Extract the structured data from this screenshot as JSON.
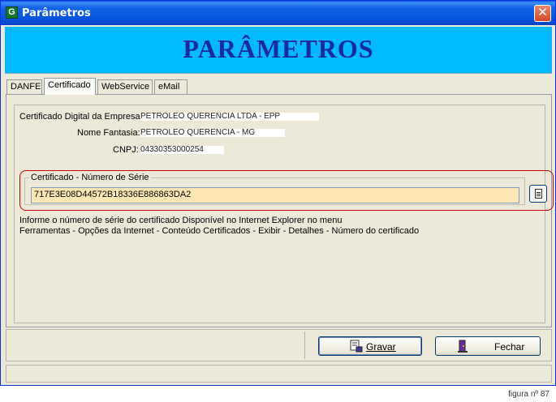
{
  "window": {
    "title": "Parâmetros",
    "close_glyph": "✕",
    "icon_glyph": "G"
  },
  "header": {
    "title": "PARÂMETROS"
  },
  "tabs": [
    {
      "label": "DANFE",
      "active": false
    },
    {
      "label": "Certificado",
      "active": true
    },
    {
      "label": "WebService",
      "active": false
    },
    {
      "label": "eMail",
      "active": false
    }
  ],
  "certificate": {
    "empresa_label": "Certificado Digital da Empresa:",
    "empresa_value": "PETROLEO QUERENCIA LTDA - EPP",
    "fantasia_label": "Nome Fantasia:",
    "fantasia_value": "PETROLEO QUERENCIA - MG",
    "cnpj_label": "CNPJ:",
    "cnpj_value": "04330353000254"
  },
  "serial_group": {
    "legend": "Certificado - Número de Série",
    "value": "717E3E08D44572B18336E886863DA2",
    "browse_icon": "document-icon"
  },
  "info": {
    "line1": "Informe o número de série do certificado Disponível no Internet Explorer no menu",
    "line2": "Ferramentas - Opções da Internet - Conteúdo Certificados - Exibir - Detalhes - Número do certificado"
  },
  "buttons": {
    "save_label": "Gravar",
    "close_label": "Fechar"
  },
  "caption": "figura nº 87",
  "colors": {
    "banner": "#00b9ff",
    "banner_text": "#1a2a9e",
    "serial_field_bg": "#fde8b4",
    "highlight_ring": "#cc0000"
  }
}
